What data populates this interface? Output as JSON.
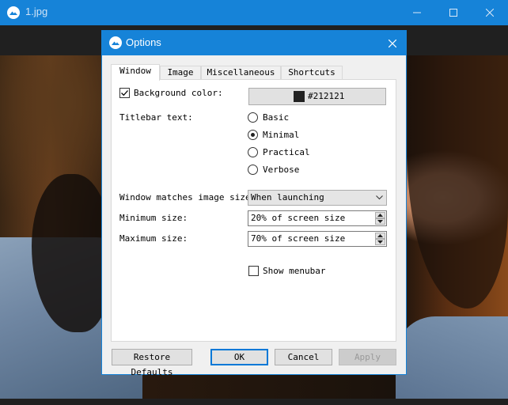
{
  "window": {
    "title": "1.jpg"
  },
  "dialog": {
    "title": "Options",
    "tabs": [
      {
        "label": "Window",
        "active": true
      },
      {
        "label": "Image",
        "active": false
      },
      {
        "label": "Miscellaneous",
        "active": false
      },
      {
        "label": "Shortcuts",
        "active": false
      }
    ],
    "background_color": {
      "label": "Background color:",
      "checked": true,
      "value": "#212121"
    },
    "titlebar_text": {
      "label": "Titlebar text:",
      "options": [
        "Basic",
        "Minimal",
        "Practical",
        "Verbose"
      ],
      "selected": "Minimal"
    },
    "window_matches_image_size": {
      "label": "Window matches image size:",
      "value": "When launching"
    },
    "minimum_size": {
      "label": "Minimum size:",
      "value": "20% of screen size"
    },
    "maximum_size": {
      "label": "Maximum size:",
      "value": "70% of screen size"
    },
    "show_menubar": {
      "label": "Show menubar",
      "checked": false
    },
    "buttons": {
      "restore": "Restore Defaults",
      "ok": "OK",
      "cancel": "Cancel",
      "apply": "Apply"
    }
  },
  "colors": {
    "accent": "#1683d8",
    "swatch": "#212121",
    "dialog_bg": "#f0f0f0"
  },
  "icons": [
    "app-icon",
    "minimize-icon",
    "maximize-icon",
    "close-icon",
    "chevron-down-icon",
    "spin-up-icon",
    "spin-down-icon",
    "checkmark-icon"
  ]
}
